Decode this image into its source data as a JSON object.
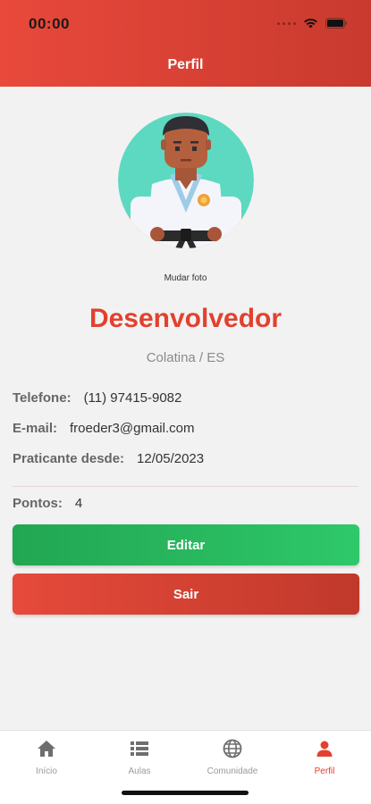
{
  "status_bar": {
    "time": "00:00"
  },
  "header": {
    "title": "Perfil"
  },
  "profile": {
    "change_photo": "Mudar foto",
    "name": "Desenvolvedor",
    "location": "Colatina / ES",
    "phone_label": "Telefone:",
    "phone": "(11) 97415-9082",
    "email_label": "E-mail:",
    "email": "froeder3@gmail.com",
    "since_label": "Praticante desde:",
    "since": "12/05/2023",
    "points_label": "Pontos:",
    "points": "4"
  },
  "buttons": {
    "edit": "Editar",
    "exit": "Sair"
  },
  "tabs": [
    {
      "label": "Início",
      "icon": "home-icon",
      "active": false
    },
    {
      "label": "Aulas",
      "icon": "list-icon",
      "active": false
    },
    {
      "label": "Comunidade",
      "icon": "globe-icon",
      "active": false
    },
    {
      "label": "Perfil",
      "icon": "user-icon",
      "active": true
    }
  ],
  "colors": {
    "accent": "#e2412f",
    "header": "#e8493b",
    "edit_button": "#2ec86a",
    "exit_button": "#c0392b"
  }
}
